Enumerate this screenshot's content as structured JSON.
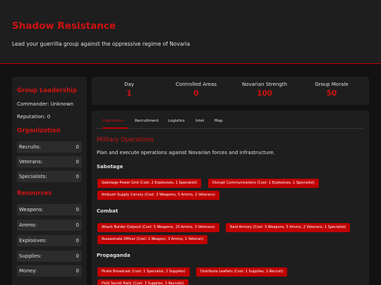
{
  "header": {
    "title": "Shadow Resistance",
    "subtitle": "Lead your guerrilla group against the oppressive regime of Novaria"
  },
  "sidebar": {
    "leadership_heading": "Group Leadership",
    "commander": "Commander: Unknown",
    "reputation": "Reputation: 0",
    "organization_heading": "Organization",
    "organization": [
      {
        "label": "Recruits:",
        "value": "0"
      },
      {
        "label": "Veterans:",
        "value": "0"
      },
      {
        "label": "Specialists:",
        "value": "0"
      }
    ],
    "resources_heading": "Resources",
    "resources": [
      {
        "label": "Weapons:",
        "value": "0"
      },
      {
        "label": "Ammo:",
        "value": "0"
      },
      {
        "label": "Explosives:",
        "value": "0"
      },
      {
        "label": "Supplies:",
        "value": "0"
      },
      {
        "label": "Money:",
        "value": "0"
      }
    ]
  },
  "stats": [
    {
      "label": "Day",
      "value": "1"
    },
    {
      "label": "Controlled Areas",
      "value": "0"
    },
    {
      "label": "Novarian Strength",
      "value": "100"
    },
    {
      "label": "Group Morale",
      "value": "50"
    }
  ],
  "tabs": [
    "Operations",
    "Recruitment",
    "Logistics",
    "Intel",
    "Map"
  ],
  "active_tab": "Operations",
  "operations": {
    "title": "Military Operations",
    "description": "Plan and execute operations against Novarian forces and infrastructure.",
    "groups": [
      {
        "name": "Sabotage",
        "actions": [
          "Sabotage Power Grid (Cost: 2 Explosives, 1 Specialist)",
          "Disrupt Communications (Cost: 1 Explosives, 1 Specialist)",
          "Ambush Supply Convoy (Cost: 3 Weapons, 5 Ammo, 2 Veterans)"
        ]
      },
      {
        "name": "Combat",
        "actions": [
          "Attack Border Outpost (Cost: 5 Weapons, 10 Ammo, 3 Veterans)",
          "Raid Armory (Cost: 3 Weapons, 5 Ammo, 2 Veterans, 1 Specialist)",
          "Assassinate Officer (Cost: 1 Weapon, 3 Ammo, 1 Veteran)"
        ]
      },
      {
        "name": "Propaganda",
        "actions": [
          "Pirate Broadcast (Cost: 1 Specialist, 2 Supplies)",
          "Distribute Leaflets (Cost: 1 Supplies, 1 Recruit)",
          "Hold Secret Rally (Cost: 3 Supplies, 3 Recruits)"
        ]
      }
    ]
  },
  "colors": {
    "accent": "#d11111",
    "button": "#c00000",
    "background": "#121212",
    "panel": "#1e1e1e",
    "row": "#2c2c2c"
  }
}
